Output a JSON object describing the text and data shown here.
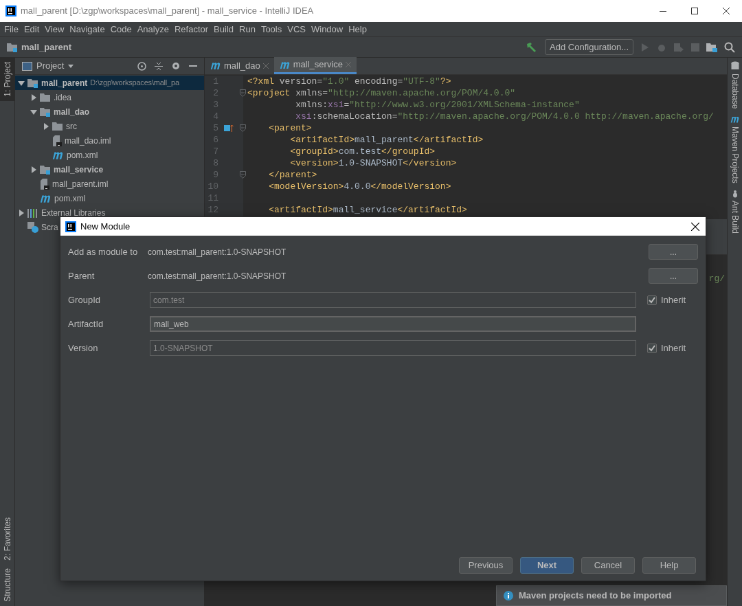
{
  "window": {
    "title": "mall_parent [D:\\zgp\\workspaces\\mall_parent] - mall_service - IntelliJ IDEA"
  },
  "menu": [
    "File",
    "Edit",
    "View",
    "Navigate",
    "Code",
    "Analyze",
    "Refactor",
    "Build",
    "Run",
    "Tools",
    "VCS",
    "Window",
    "Help"
  ],
  "breadcrumb": "mall_parent",
  "toolbar": {
    "run_config": "Add Configuration..."
  },
  "left_strip": [
    {
      "label": "1: Project",
      "selected": true,
      "kind": "top"
    },
    {
      "label": "2: Favorites",
      "selected": false,
      "kind": "bottom"
    },
    {
      "label": "Structure",
      "selected": false,
      "kind": "bottom"
    }
  ],
  "project_panel": {
    "title": "Project",
    "tree": [
      {
        "label": "mall_parent",
        "path": "D:\\zgp\\workspaces\\mall_pa",
        "kind": "module",
        "expanded": true,
        "selected": true,
        "children": [
          {
            "label": ".idea",
            "kind": "folder",
            "expanded": false,
            "selected": false
          },
          {
            "label": "mall_dao",
            "kind": "module",
            "expanded": true,
            "selected": false,
            "children": [
              {
                "label": "src",
                "kind": "folder",
                "expanded": false,
                "selected": false
              },
              {
                "label": "mall_dao.iml",
                "kind": "iml",
                "selected": false
              },
              {
                "label": "pom.xml",
                "kind": "pom",
                "selected": false
              }
            ]
          },
          {
            "label": "mall_service",
            "kind": "module",
            "expanded": false,
            "selected": false
          },
          {
            "label": "mall_parent.iml",
            "kind": "iml",
            "selected": false
          },
          {
            "label": "pom.xml",
            "kind": "pom",
            "selected": false
          }
        ]
      },
      {
        "label": "External Libraries",
        "kind": "libraries",
        "expanded": false,
        "selected": false
      },
      {
        "label": "Scra",
        "kind": "scratches",
        "selected": false
      }
    ]
  },
  "editor": {
    "tabs": [
      {
        "label": "mall_dao",
        "selected": false
      },
      {
        "label": "mall_service",
        "selected": true
      }
    ],
    "lines": [
      {
        "number": "1",
        "segments": [
          {
            "kind": "tag",
            "text": "<?xml "
          },
          {
            "kind": "attr",
            "text": "version="
          },
          {
            "kind": "value",
            "text": "\"1.0\""
          },
          {
            "kind": "attr",
            "text": " encoding="
          },
          {
            "kind": "value",
            "text": "\"UTF-8\""
          },
          {
            "kind": "tag",
            "text": "?>"
          }
        ]
      },
      {
        "number": "2",
        "fold": true,
        "segments": [
          {
            "kind": "tag",
            "text": "<project "
          },
          {
            "kind": "attr",
            "text": "xmlns="
          },
          {
            "kind": "value",
            "text": "\"http://maven.apache.org/POM/4.0.0\""
          }
        ]
      },
      {
        "number": "3",
        "segments": [
          {
            "kind": "attr",
            "text": "         xmlns:"
          },
          {
            "kind": "ns",
            "text": "xsi"
          },
          {
            "kind": "attr",
            "text": "="
          },
          {
            "kind": "value",
            "text": "\"http://www.w3.org/2001/XMLSchema-instance\""
          }
        ]
      },
      {
        "number": "4",
        "segments": [
          {
            "kind": "ns",
            "text": "         xsi"
          },
          {
            "kind": "attr",
            "text": ":schemaLocation="
          },
          {
            "kind": "value",
            "text": "\"http://maven.apache.org/POM/4.0.0 http://maven.apache.org/"
          }
        ]
      },
      {
        "number": "5",
        "fold": true,
        "maven_mark": true,
        "segments": [
          {
            "kind": "tag",
            "text": "    <parent>"
          }
        ]
      },
      {
        "number": "6",
        "segments": [
          {
            "kind": "tag",
            "text": "        <artifactId>"
          },
          {
            "kind": "text",
            "text": "mall_parent"
          },
          {
            "kind": "tag",
            "text": "</artifactId>"
          }
        ]
      },
      {
        "number": "7",
        "segments": [
          {
            "kind": "tag",
            "text": "        <groupId>"
          },
          {
            "kind": "text",
            "text": "com.test"
          },
          {
            "kind": "tag",
            "text": "</groupId>"
          }
        ]
      },
      {
        "number": "8",
        "segments": [
          {
            "kind": "tag",
            "text": "        <version>"
          },
          {
            "kind": "text",
            "text": "1.0-SNAPSHOT"
          },
          {
            "kind": "tag",
            "text": "</version>"
          }
        ]
      },
      {
        "number": "9",
        "fold": true,
        "segments": [
          {
            "kind": "tag",
            "text": "    </parent>"
          }
        ]
      },
      {
        "number": "10",
        "segments": [
          {
            "kind": "tag",
            "text": "    <modelVersion>"
          },
          {
            "kind": "text",
            "text": "4.0.0"
          },
          {
            "kind": "tag",
            "text": "</modelVersion>"
          }
        ]
      },
      {
        "number": "11"
      },
      {
        "number": "12",
        "segments": [
          {
            "kind": "tag",
            "text": "    <artifactId>"
          },
          {
            "kind": "text",
            "text": "mall_service"
          },
          {
            "kind": "tag",
            "text": "</artifactId>"
          }
        ]
      }
    ],
    "lower_fragment": "rg/"
  },
  "right_strip": [
    {
      "label": "Database",
      "kind": "database"
    },
    {
      "label": "Maven Projects",
      "kind": "maven"
    },
    {
      "label": "Ant Build",
      "kind": "ant"
    }
  ],
  "dialog": {
    "title": "New Module",
    "rows": [
      {
        "label": "Add as module to",
        "kind": "text",
        "value": "com.test:mall_parent:1.0-SNAPSHOT",
        "button": "..."
      },
      {
        "label": "Parent",
        "kind": "text",
        "value": "com.test:mall_parent:1.0-SNAPSHOT",
        "button": "..."
      },
      {
        "label": "GroupId",
        "kind": "field",
        "value": "com.test",
        "disabled": true,
        "focused": false,
        "inherit": {
          "label": "Inherit",
          "checked": true
        }
      },
      {
        "label": "ArtifactId",
        "kind": "field",
        "value": "mall_web",
        "disabled": false,
        "focused": true
      },
      {
        "label": "Version",
        "kind": "field",
        "value": "1.0-SNAPSHOT",
        "disabled": true,
        "focused": false,
        "inherit": {
          "label": "Inherit",
          "checked": true
        }
      }
    ],
    "buttons": [
      {
        "label": "Previous",
        "kind": "default"
      },
      {
        "label": "Next",
        "kind": "primary"
      },
      {
        "label": "Cancel",
        "kind": "default"
      },
      {
        "label": "Help",
        "kind": "default"
      }
    ]
  },
  "notification": {
    "text": "Maven projects need to be imported"
  }
}
